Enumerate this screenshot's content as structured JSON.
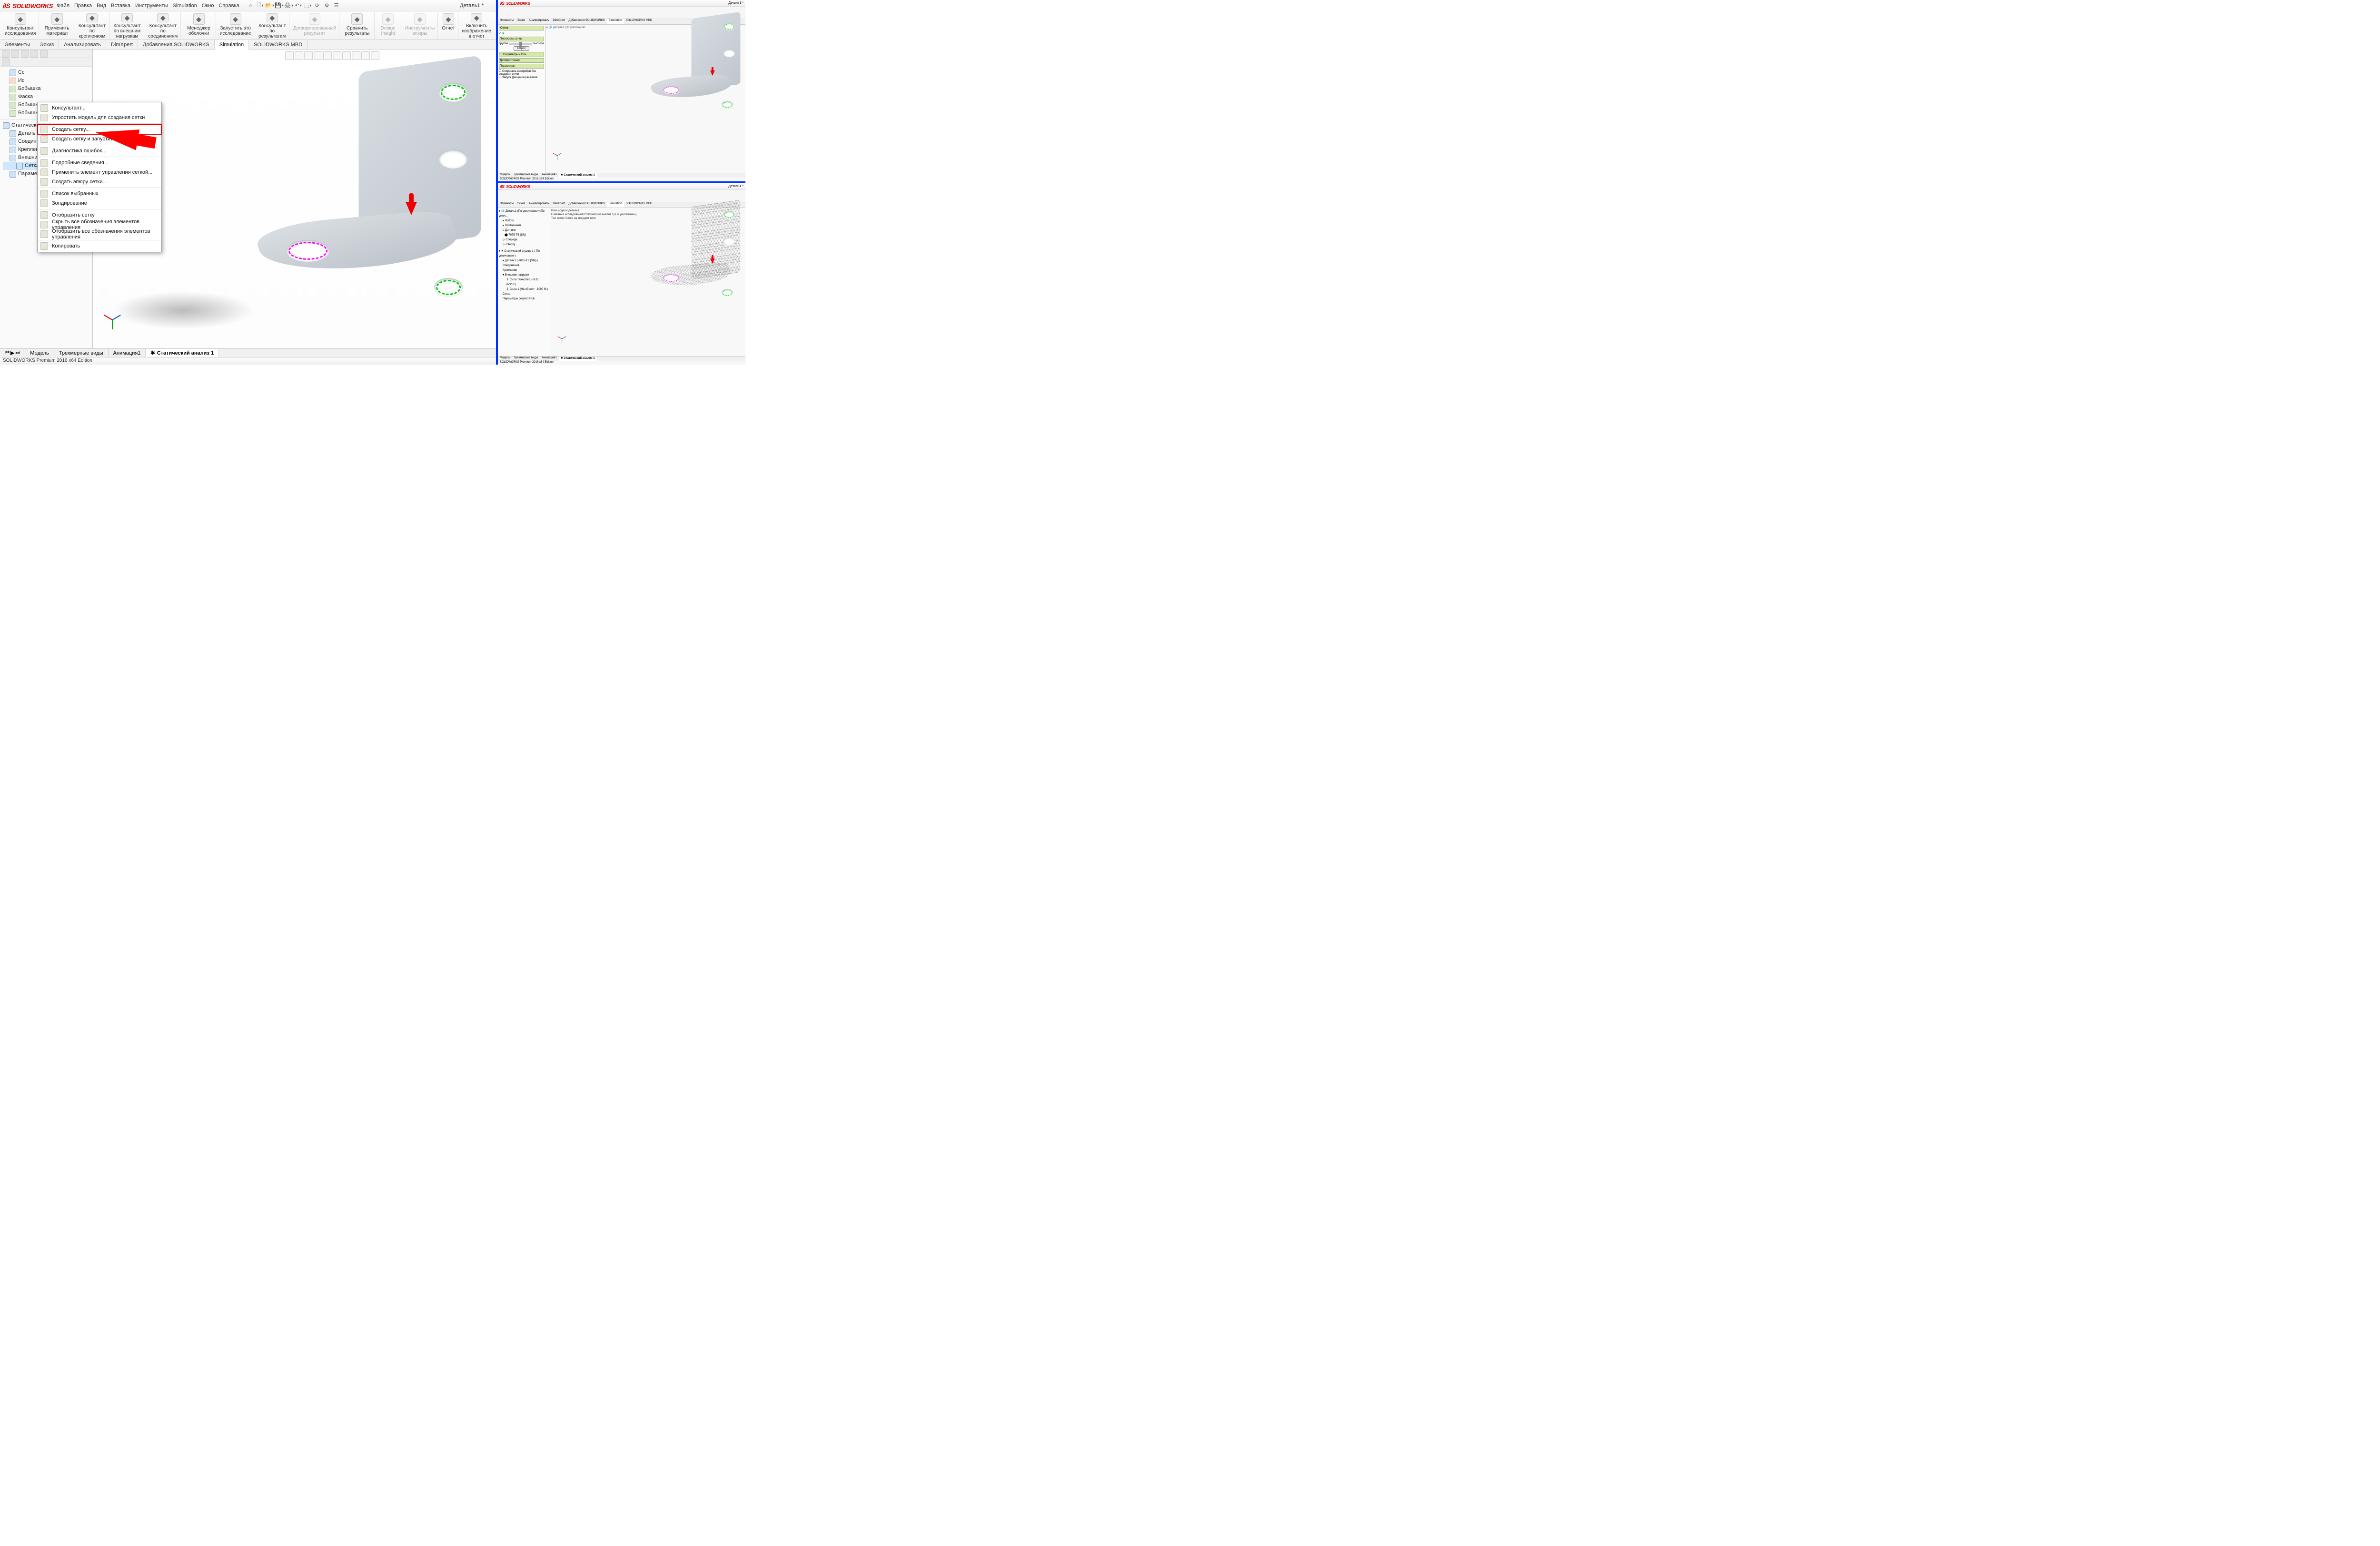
{
  "app": {
    "logo": "SOLIDWORKS",
    "doc_title": "Деталь1 *"
  },
  "menu": [
    "Файл",
    "Правка",
    "Вид",
    "Вставка",
    "Инструменты",
    "Simulation",
    "Окно",
    "Справка"
  ],
  "ribbon": [
    {
      "label": "Консультант исследования",
      "icon": "advisor",
      "gray": false
    },
    {
      "label": "Применить материал",
      "icon": "material",
      "gray": false
    },
    {
      "label": "Консультант по креплениям",
      "icon": "fixtures",
      "gray": false
    },
    {
      "label": "Консультант по внешним нагрузкам",
      "icon": "loads",
      "gray": false
    },
    {
      "label": "Консультант по соединениям",
      "icon": "connections",
      "gray": false
    },
    {
      "label": "Менеджер оболочки",
      "icon": "shell",
      "gray": false
    },
    {
      "label": "Запустить это исследование",
      "icon": "run",
      "gray": false
    },
    {
      "label": "Консультант по результатам",
      "icon": "results",
      "gray": false
    },
    {
      "label": "Деформированный результат",
      "icon": "deform",
      "gray": true
    },
    {
      "label": "Сравнить результаты",
      "icon": "compare",
      "gray": false
    },
    {
      "label": "Design Insight",
      "icon": "insight",
      "gray": true
    },
    {
      "label": "Инструменты эпюры",
      "icon": "plottools",
      "gray": true
    },
    {
      "label": "Отчет",
      "icon": "report",
      "gray": false
    },
    {
      "label": "Включить изображение в отчет",
      "icon": "include",
      "gray": false
    }
  ],
  "tabs": [
    "Элементы",
    "Эскиз",
    "Анализировать",
    "DimXpert",
    "Добавления SOLIDWORKS",
    "Simulation",
    "SOLIDWORKS MBD"
  ],
  "active_tab": "Simulation",
  "tree": {
    "top": [
      {
        "t": "Сс",
        "ic": "b"
      },
      {
        "t": "Ис",
        "ic": "p"
      },
      {
        "t": "Бобышка",
        "ic": "ic"
      },
      {
        "t": "Фаска",
        "ic": "ic"
      },
      {
        "t": "Бобышка",
        "ic": "ic"
      },
      {
        "t": "Бобышка",
        "ic": "ic"
      }
    ],
    "study": "Статический",
    "nodes": [
      {
        "t": "Деталь",
        "indent": 1
      },
      {
        "t": "Соединения",
        "indent": 1
      },
      {
        "t": "Крепления",
        "indent": 1
      },
      {
        "t": "Внешние нагрузки",
        "indent": 1
      },
      {
        "t": "Сетка",
        "indent": 2,
        "sel": true
      },
      {
        "t": "Параметры результатов",
        "indent": 1
      }
    ]
  },
  "context_menu": [
    {
      "label": "Консультант...",
      "sep": false
    },
    {
      "label": "Упростить модель для создания сетки",
      "sep": true
    },
    {
      "label": "Создать сетку...",
      "hl": true
    },
    {
      "label": "Создать сетку и запустить",
      "sep": true
    },
    {
      "label": "Диагностика ошибок...",
      "sep": true
    },
    {
      "label": "Подробные сведения...",
      "sep": false
    },
    {
      "label": "Применить элемент управления сеткой...",
      "sep": false
    },
    {
      "label": "Создать эпюру сетки...",
      "sep": true
    },
    {
      "label": "Список выбранных",
      "sep": false
    },
    {
      "label": "Зондирование",
      "sep": true
    },
    {
      "label": "Отобразить сетку",
      "sep": false
    },
    {
      "label": "Скрыть все обозначения элементов управления",
      "sep": false
    },
    {
      "label": "Отобразить все обозначения элементов управления",
      "sep": true
    },
    {
      "label": "Копировать",
      "sep": false
    }
  ],
  "bottom_tabs": [
    "Модель",
    "Трехмерные виды",
    "Анимация1",
    "Статический анализ 1"
  ],
  "active_bottom": "Статический анализ 1",
  "status": "SOLIDWORKS Premium 2016 x64 Edition",
  "thumbs": {
    "top": {
      "panel_title": "Сетка",
      "density": "Плотность сетки",
      "coarse": "Грубое",
      "fine": "Высокое",
      "reset": "Сброс",
      "params": "Параметры сетки",
      "adv": "Дополнительно",
      "opts": "Параметры",
      "o1": "Сохранить настройки без создания сетки",
      "o2": "Запуск (решение) анализа",
      "tab": "Статический анализ 1"
    },
    "bottom": {
      "msg1": "Имя модели:Деталь1",
      "msg2": "Название исследования:Статический анализ 1(-По умолчанию-)",
      "msg3": "Тип сетки: Сетка на твердом теле",
      "tree": [
        "History",
        "Примечания",
        "Датчики",
        "7075-T6 (SN)",
        "Спереди",
        "Сверху"
      ],
      "study": "Статический анализ 1 (-По умолчанию-)",
      "sub": [
        "Деталь1 (-7075-T6 (SN)-)",
        "Соединения",
        "Крепления",
        "Внешние нагрузки",
        "Сила тяжести-1 (-9.81 m/s^2:)",
        "Сила-1 (На объект: -1000 N:)",
        "Сетка",
        "Параметры результатов"
      ],
      "tab": "Статический анализ 1"
    }
  }
}
